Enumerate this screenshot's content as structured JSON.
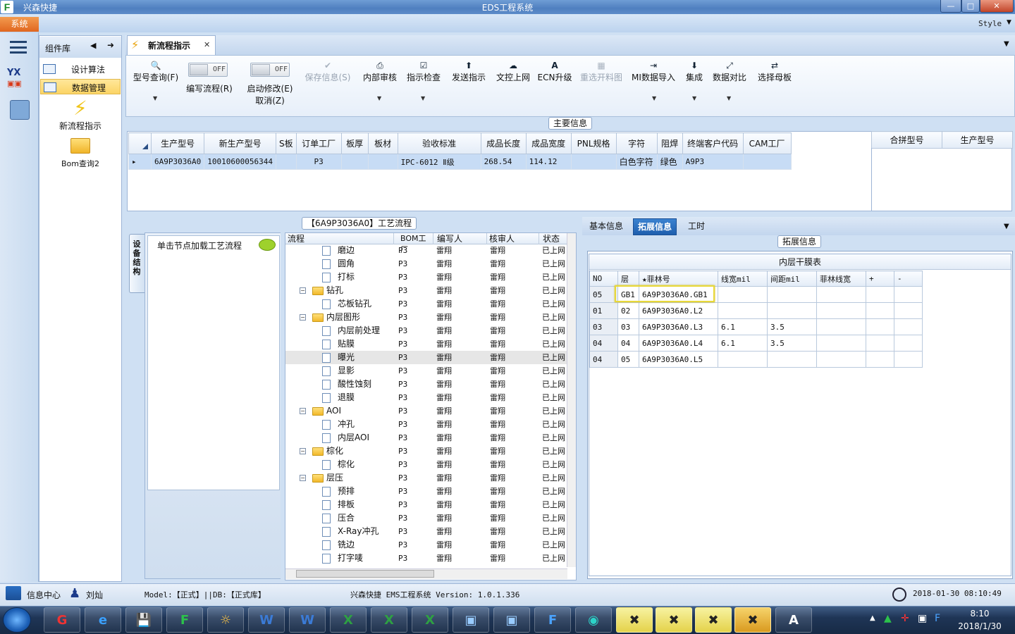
{
  "app": {
    "name": "兴森快捷",
    "window_title": "EDS工程系统",
    "system_menu": "系统",
    "style_label": "Style"
  },
  "components": {
    "title": "组件库",
    "items": [
      {
        "label": "设计算法"
      },
      {
        "label": "数据管理",
        "selected": true
      },
      {
        "label": "新流程指示"
      },
      {
        "label": "Bom查询2"
      }
    ]
  },
  "doc_tab": {
    "title": "新流程指示"
  },
  "ribbon": {
    "buttons": [
      {
        "label": "型号查询(F)",
        "icon": "search-icon"
      },
      {
        "label": "编写流程(R)",
        "toggle": "OFF"
      },
      {
        "label": "启动修改(E)",
        "sub": "取消(Z)",
        "toggle": "OFF"
      },
      {
        "label": "保存信息(S)",
        "icon": "check-icon",
        "disabled": true
      },
      {
        "label": "内部审核",
        "icon": "printer-icon"
      },
      {
        "label": "指示检查",
        "icon": "checkbox-icon"
      },
      {
        "label": "发送指示",
        "icon": "upload-icon"
      },
      {
        "label": "文控上网",
        "icon": "cloud-upload-icon"
      },
      {
        "label": "ECN升级",
        "icon": "font-icon"
      },
      {
        "label": "重选开料图",
        "icon": "image-icon",
        "disabled": true
      },
      {
        "label": "MI数据导入",
        "icon": "import-icon"
      },
      {
        "label": "集成",
        "icon": "download-icon"
      },
      {
        "label": "数据对比",
        "icon": "compare-icon"
      },
      {
        "label": "选择母板",
        "icon": "shuffle-icon"
      }
    ]
  },
  "main_info": {
    "group_title": "主要信息",
    "columns": [
      "生产型号",
      "新生产型号",
      "S板",
      "订单工厂",
      "板厚",
      "板材",
      "验收标准",
      "成品长度",
      "成品宽度",
      "PNL规格",
      "字符",
      "阻焊",
      "终端客户代码",
      "CAM工厂"
    ],
    "rows": [
      [
        "6A9P3036A0",
        "10010600056344",
        "",
        "P3",
        "",
        "",
        "IPC-6012 Ⅱ级",
        "268.54",
        "114.12",
        "",
        "白色字符",
        "绿色",
        "A9P3",
        ""
      ]
    ],
    "merge_columns": [
      "合拼型号",
      "生产型号"
    ]
  },
  "device_panel": {
    "tab": "设备结构",
    "hint": "单击节点加载工艺流程"
  },
  "process": {
    "title": "【6A9P3036A0】工艺流程",
    "columns": [
      "流程",
      "BOM工厂",
      "编写人",
      "核审人",
      "状态"
    ],
    "rows": [
      {
        "name": "磨边",
        "level": 2,
        "kind": "doc",
        "factory": "P3",
        "writer": "雷翔",
        "reviewer": "雷翔",
        "status": "已上网"
      },
      {
        "name": "圆角",
        "level": 2,
        "kind": "doc",
        "factory": "P3",
        "writer": "雷翔",
        "reviewer": "雷翔",
        "status": "已上网"
      },
      {
        "name": "打标",
        "level": 2,
        "kind": "doc",
        "factory": "P3",
        "writer": "雷翔",
        "reviewer": "雷翔",
        "status": "已上网"
      },
      {
        "name": "钻孔",
        "level": 1,
        "kind": "folder",
        "factory": "P3",
        "writer": "雷翔",
        "reviewer": "雷翔",
        "status": "已上网"
      },
      {
        "name": "芯板钻孔",
        "level": 2,
        "kind": "doc",
        "factory": "P3",
        "writer": "雷翔",
        "reviewer": "雷翔",
        "status": "已上网"
      },
      {
        "name": "内层图形",
        "level": 1,
        "kind": "folder",
        "factory": "P3",
        "writer": "雷翔",
        "reviewer": "雷翔",
        "status": "已上网"
      },
      {
        "name": "内层前处理",
        "level": 2,
        "kind": "doc",
        "factory": "P3",
        "writer": "雷翔",
        "reviewer": "雷翔",
        "status": "已上网"
      },
      {
        "name": "贴膜",
        "level": 2,
        "kind": "doc",
        "factory": "P3",
        "writer": "雷翔",
        "reviewer": "雷翔",
        "status": "已上网"
      },
      {
        "name": "曝光",
        "level": 2,
        "kind": "doc",
        "factory": "P3",
        "writer": "雷翔",
        "reviewer": "雷翔",
        "status": "已上网",
        "highlight": true
      },
      {
        "name": "显影",
        "level": 2,
        "kind": "doc",
        "factory": "P3",
        "writer": "雷翔",
        "reviewer": "雷翔",
        "status": "已上网"
      },
      {
        "name": "酸性蚀刻",
        "level": 2,
        "kind": "doc",
        "factory": "P3",
        "writer": "雷翔",
        "reviewer": "雷翔",
        "status": "已上网"
      },
      {
        "name": "退膜",
        "level": 2,
        "kind": "doc",
        "factory": "P3",
        "writer": "雷翔",
        "reviewer": "雷翔",
        "status": "已上网"
      },
      {
        "name": "AOI",
        "level": 1,
        "kind": "folder",
        "factory": "P3",
        "writer": "雷翔",
        "reviewer": "雷翔",
        "status": "已上网"
      },
      {
        "name": "冲孔",
        "level": 2,
        "kind": "doc",
        "factory": "P3",
        "writer": "雷翔",
        "reviewer": "雷翔",
        "status": "已上网"
      },
      {
        "name": "内层AOI",
        "level": 2,
        "kind": "doc",
        "factory": "P3",
        "writer": "雷翔",
        "reviewer": "雷翔",
        "status": "已上网"
      },
      {
        "name": "棕化",
        "level": 1,
        "kind": "folder",
        "factory": "P3",
        "writer": "雷翔",
        "reviewer": "雷翔",
        "status": "已上网"
      },
      {
        "name": "棕化",
        "level": 2,
        "kind": "doc",
        "factory": "P3",
        "writer": "雷翔",
        "reviewer": "雷翔",
        "status": "已上网"
      },
      {
        "name": "层压",
        "level": 1,
        "kind": "folder",
        "factory": "P3",
        "writer": "雷翔",
        "reviewer": "雷翔",
        "status": "已上网"
      },
      {
        "name": "预排",
        "level": 2,
        "kind": "doc",
        "factory": "P3",
        "writer": "雷翔",
        "reviewer": "雷翔",
        "status": "已上网"
      },
      {
        "name": "排板",
        "level": 2,
        "kind": "doc",
        "factory": "P3",
        "writer": "雷翔",
        "reviewer": "雷翔",
        "status": "已上网"
      },
      {
        "name": "压合",
        "level": 2,
        "kind": "doc",
        "factory": "P3",
        "writer": "雷翔",
        "reviewer": "雷翔",
        "status": "已上网"
      },
      {
        "name": "X-Ray冲孔",
        "level": 2,
        "kind": "doc",
        "factory": "P3",
        "writer": "雷翔",
        "reviewer": "雷翔",
        "status": "已上网"
      },
      {
        "name": "铣边",
        "level": 2,
        "kind": "doc",
        "factory": "P3",
        "writer": "雷翔",
        "reviewer": "雷翔",
        "status": "已上网"
      },
      {
        "name": "打字唛",
        "level": 2,
        "kind": "doc",
        "factory": "P3",
        "writer": "雷翔",
        "reviewer": "雷翔",
        "status": "已上网"
      }
    ]
  },
  "right_panel": {
    "tabs": [
      "基本信息",
      "拓展信息",
      "工时"
    ],
    "active_tab": "拓展信息",
    "group_title": "拓展信息",
    "film_table": {
      "title": "内层干膜表",
      "columns": [
        "NO",
        "层",
        "★菲林号",
        "线宽mil",
        "间距mil",
        "菲林线宽",
        "+",
        "-"
      ],
      "rows": [
        [
          "05",
          "GB1",
          "6A9P3036A0.GB1",
          "",
          "",
          "",
          "",
          ""
        ],
        [
          "01",
          "02",
          "6A9P3036A0.L2",
          "",
          "",
          "",
          "",
          ""
        ],
        [
          "03",
          "03",
          "6A9P3036A0.L3",
          "6.1",
          "3.5",
          "",
          "",
          ""
        ],
        [
          "04",
          "04",
          "6A9P3036A0.L4",
          "6.1",
          "3.5",
          "",
          "",
          ""
        ],
        [
          "04",
          "05",
          "6A9P3036A0.L5",
          "",
          "",
          "",
          "",
          ""
        ]
      ]
    }
  },
  "status": {
    "info_center": "信息中心",
    "user": "刘灿",
    "model": "Model:【正式】||DB:【正式库】",
    "product": "兴森快捷 EMS工程系统 Version: 1.0.1.336",
    "datetime": "2018-01-30 08:10:49"
  },
  "taskbar": {
    "time": "8:10",
    "date": "2018/1/30"
  }
}
